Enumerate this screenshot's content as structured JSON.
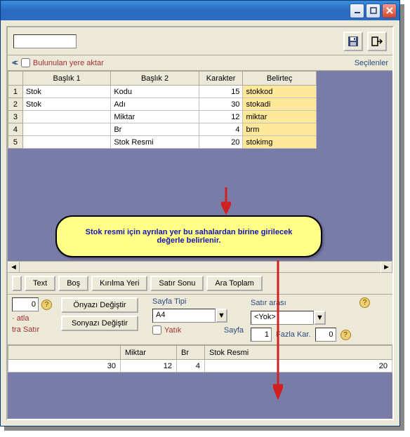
{
  "titlebar": {},
  "toolbar": {},
  "checkbox": {
    "label": "Bulunulan yere aktar"
  },
  "secilenler": "Seçilenler",
  "grid": {
    "headers": {
      "h1": "Başlık 1",
      "h2": "Başlık 2",
      "h3": "Karakter",
      "h4": "Belirteç"
    },
    "rows": {
      "r1": {
        "n": "1",
        "b1": "Stok",
        "b2": "Kodu",
        "kar": "15",
        "bel": "stokkod"
      },
      "r2": {
        "n": "2",
        "b1": "Stok",
        "b2": "Adı",
        "kar": "30",
        "bel": "stokadi"
      },
      "r3": {
        "n": "3",
        "b1": "",
        "b2": "Miktar",
        "kar": "12",
        "bel": "miktar"
      },
      "r4": {
        "n": "4",
        "b1": "",
        "b2": "Br",
        "kar": "4",
        "bel": "brm"
      },
      "r5": {
        "n": "5",
        "b1": "",
        "b2": "Stok Resmi",
        "kar": "20",
        "bel": "stokimg"
      }
    }
  },
  "callout": "Stok resmi için ayrılan yer bu sahalardan birine girilecek değerle belirlenir.",
  "buttons": {
    "text": "Text",
    "bos": "Boş",
    "kirilma": "Kırılma Yeri",
    "satir": "Satır Sonu",
    "ara": "Ara Toplam"
  },
  "lower": {
    "zero": "0",
    "onyazi": "Önyazı Değiştir",
    "sonyazi": "Sonyazı Değiştir",
    "atla": "· atla",
    "trasatir": "tra Satır",
    "sayfatipi": "Sayfa Tipi",
    "a4": "A4",
    "yatik": "Yatık",
    "sayfa": "Sayfa",
    "satirarasi": "Satır arası",
    "yok": "<Yok>",
    "one": "1",
    "fazla": "Fazla Kar.",
    "zero2": "0"
  },
  "grid2": {
    "headers": {
      "h1": "",
      "h2": "Miktar",
      "h3": "Br",
      "h4": "Stok Resmi"
    },
    "row": {
      "c1": "30",
      "c2": "12",
      "c3": "4",
      "c4": "20"
    }
  }
}
